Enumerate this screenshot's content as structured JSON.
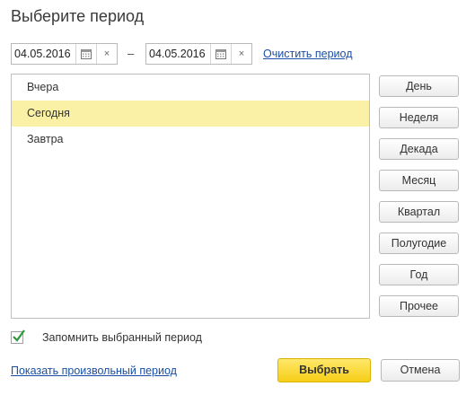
{
  "dialog": {
    "title": "Выберите период"
  },
  "date_range": {
    "start": "04.05.2016",
    "end": "04.05.2016",
    "separator": "–",
    "clear_icon": "×",
    "clear_link": "Очистить период"
  },
  "list": {
    "items": [
      {
        "label": "Вчера"
      },
      {
        "label": "Сегодня",
        "selected": true
      },
      {
        "label": "Завтра"
      }
    ]
  },
  "period_buttons": [
    "День",
    "Неделя",
    "Декада",
    "Месяц",
    "Квартал",
    "Полугодие",
    "Год",
    "Прочее"
  ],
  "remember": {
    "label": "Запомнить выбранный период",
    "checked": true
  },
  "footer": {
    "show_custom_link": "Показать произвольный период",
    "select_label": "Выбрать",
    "cancel_label": "Отмена"
  },
  "colors": {
    "selected_row": "#fbf1a6",
    "primary_button": "#f6cf17",
    "link": "#1a4fa3",
    "checkmark": "#2e9a3a"
  }
}
